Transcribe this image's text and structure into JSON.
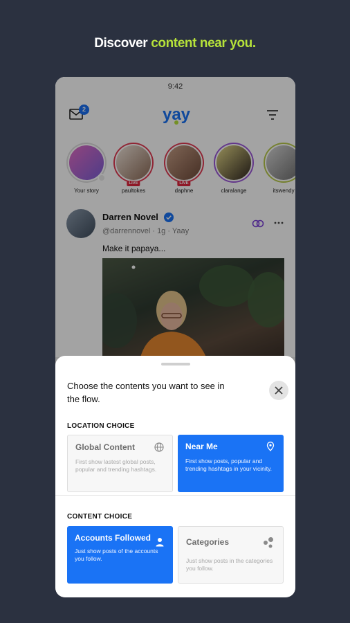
{
  "headline": {
    "prefix": "Discover",
    "accent": "content near you."
  },
  "status": {
    "time": "9:42"
  },
  "topbar": {
    "inbox_badge": "2",
    "logo_text": "yay"
  },
  "stories": [
    {
      "name": "Your story",
      "live": "",
      "ring": "#dddddd"
    },
    {
      "name": "paultokes",
      "live": "LIVE",
      "ring": "#e23a52"
    },
    {
      "name": "daphne",
      "live": "LIVE",
      "ring": "#e23a52"
    },
    {
      "name": "claralange",
      "live": "",
      "ring": "#9c57d8"
    },
    {
      "name": "itswendy",
      "live": "",
      "ring": "#b8c94a"
    }
  ],
  "post": {
    "author": "Darren Novel",
    "handle": "@darrennovel",
    "age": "1g",
    "source": "Yaay",
    "caption": "Make it papaya..."
  },
  "sheet": {
    "title": "Choose the contents you want to see in the flow.",
    "location_label": "LOCATION CHOICE",
    "content_label": "CONTENT CHOICE",
    "location_options": [
      {
        "title": "Global Content",
        "desc": "First show lastest global posts, popular and trending hashtags.",
        "icon": "globe-icon",
        "selected": false
      },
      {
        "title": "Near Me",
        "desc": "First show posts, popular and trending hashtags in your vicinity.",
        "icon": "location-pin-icon",
        "selected": true
      }
    ],
    "content_options": [
      {
        "title": "Accounts Followed",
        "desc": "Just show posts of the accounts you follow.",
        "icon": "person-icon",
        "selected": true
      },
      {
        "title": "Categories",
        "desc": "Just show posts in the categories you follow.",
        "icon": "categories-icon",
        "selected": false
      }
    ]
  },
  "colors": {
    "background": "#2b3140",
    "accent_green": "#b6e23a",
    "primary_blue": "#1a73f5",
    "live_red": "#e0263e"
  }
}
